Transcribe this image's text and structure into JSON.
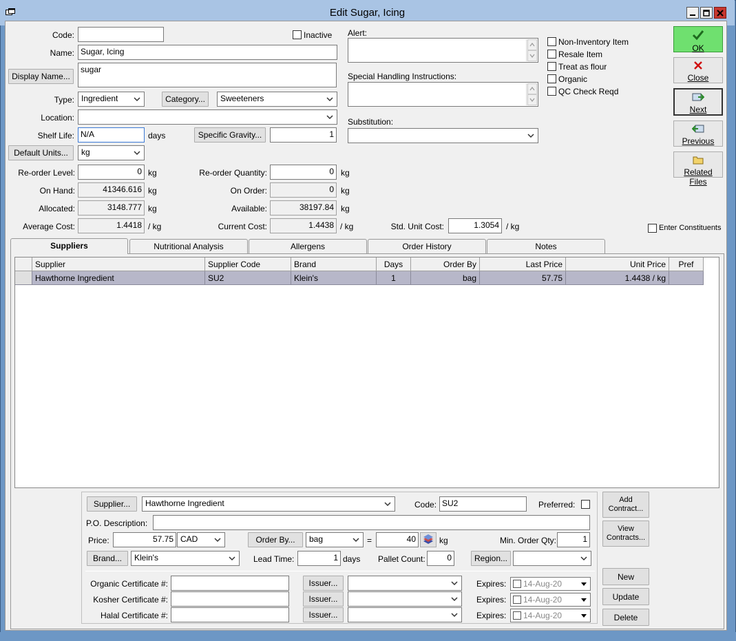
{
  "window": {
    "title": "Edit Sugar, Icing"
  },
  "form": {
    "code_label": "Code:",
    "code_value": "",
    "inactive_label": "Inactive",
    "name_label": "Name:",
    "name_value": "Sugar, Icing",
    "display_name_button": "Display Name...",
    "display_name_value": "sugar",
    "type_label": "Type:",
    "type_value": "Ingredient",
    "category_button": "Category...",
    "category_value": "Sweeteners",
    "location_label": "Location:",
    "location_value": "",
    "shelf_life_label": "Shelf Life:",
    "shelf_life_value": "N/A",
    "shelf_life_unit": "days",
    "specific_gravity_button": "Specific Gravity...",
    "specific_gravity_value": "1",
    "default_units_button": "Default Units...",
    "default_units_value": "kg",
    "reorder_level_label": "Re-order Level:",
    "reorder_level_value": "0",
    "reorder_qty_label": "Re-order Quantity:",
    "reorder_qty_value": "0",
    "on_hand_label": "On Hand:",
    "on_hand_value": "41346.616",
    "on_order_label": "On Order:",
    "on_order_value": "0",
    "allocated_label": "Allocated:",
    "allocated_value": "3148.777",
    "available_label": "Available:",
    "available_value": "38197.84",
    "average_cost_label": "Average Cost:",
    "average_cost_value": "1.4418",
    "current_cost_label": "Current Cost:",
    "current_cost_value": "1.4438",
    "std_unit_cost_label": "Std. Unit Cost:",
    "std_unit_cost_value": "1.3054",
    "unit_kg": "kg",
    "unit_per_kg": "/ kg",
    "alert_label": "Alert:",
    "special_handling_label": "Special Handling Instructions:",
    "substitution_label": "Substitution:",
    "substitution_value": "",
    "enter_constituents_label": "Enter Constituents"
  },
  "flags": [
    {
      "label": "Non-Inventory Item"
    },
    {
      "label": "Resale Item"
    },
    {
      "label": "Treat as flour"
    },
    {
      "label": "Organic"
    },
    {
      "label": "QC Check Reqd"
    }
  ],
  "side_buttons": {
    "ok": "OK",
    "close": "Close",
    "next": "Next",
    "previous": "Previous",
    "related_files": "Related Files"
  },
  "tabs": [
    {
      "label": "Suppliers"
    },
    {
      "label": "Nutritional Analysis"
    },
    {
      "label": "Allergens"
    },
    {
      "label": "Order History"
    },
    {
      "label": "Notes"
    }
  ],
  "grid": {
    "headers": [
      "Supplier",
      "Supplier Code",
      "Brand",
      "Days",
      "Order By",
      "Last Price",
      "Unit Price",
      "Pref"
    ],
    "rows": [
      [
        "Hawthorne Ingredient",
        "SU2",
        "Klein's",
        "1",
        "bag",
        "57.75",
        "1.4438 / kg",
        ""
      ]
    ]
  },
  "supplier": {
    "supplier_button": "Supplier...",
    "supplier_value": "Hawthorne Ingredient",
    "code_label": "Code:",
    "code_value": "SU2",
    "preferred_label": "Preferred:",
    "po_description_label": "P.O. Description:",
    "po_description_value": "",
    "price_label": "Price:",
    "price_value": "57.75",
    "currency_value": "CAD",
    "order_by_button": "Order By...",
    "order_by_value": "bag",
    "equals": "=",
    "conversion_value": "40",
    "conversion_unit": "kg",
    "min_order_label": "Min. Order Qty:",
    "min_order_value": "1",
    "brand_button": "Brand...",
    "brand_value": "Klein's",
    "lead_time_label": "Lead Time:",
    "lead_time_value": "1",
    "lead_time_unit": "days",
    "pallet_count_label": "Pallet Count:",
    "pallet_count_value": "0",
    "region_button": "Region...",
    "region_value": "",
    "add_contract_button_l1": "Add",
    "add_contract_button_l2": "Contract...",
    "view_contracts_button_l1": "View",
    "view_contracts_button_l2": "Contracts...",
    "new_button": "New",
    "update_button": "Update",
    "delete_button": "Delete"
  },
  "certificates": [
    {
      "label": "Organic Certificate #:",
      "value": "",
      "issuer_button": "Issuer...",
      "issuer_value": "",
      "expires_label": "Expires:",
      "expires_value": "14-Aug-20"
    },
    {
      "label": "Kosher Certificate #:",
      "value": "",
      "issuer_button": "Issuer...",
      "issuer_value": "",
      "expires_label": "Expires:",
      "expires_value": "14-Aug-20"
    },
    {
      "label": "Halal Certificate #:",
      "value": "",
      "issuer_button": "Issuer...",
      "issuer_value": "",
      "expires_label": "Expires:",
      "expires_value": "14-Aug-20"
    }
  ]
}
